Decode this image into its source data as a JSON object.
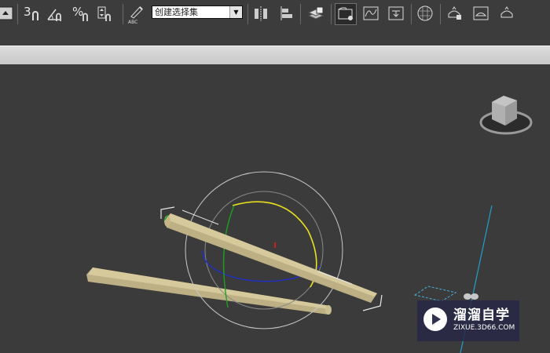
{
  "toolbar": {
    "snap_3_label": "3",
    "percent_label": "%",
    "abc_label": "ABC",
    "selection_set": {
      "value": "创建选择集"
    },
    "icons": [
      "undo-icon",
      "snap-3d-icon",
      "angle-snap-icon",
      "percent-snap-icon",
      "spinner-snap-icon",
      "edit-named-selection-icon",
      "mirror-icon",
      "align-icon",
      "layer-manager-icon",
      "scene-explorer-icon",
      "curve-editor-icon",
      "schematic-view-icon",
      "material-editor-icon",
      "render-setup-icon",
      "rendered-frame-window-icon",
      "render-production-icon"
    ]
  },
  "watermark": {
    "title": "溜溜自学",
    "url": "ZIXUE.3D66.COM"
  },
  "colors": {
    "viewport_bg": "#3b3b3b",
    "object_tan": "#c7b98a",
    "gizmo_x": "#d02020",
    "gizmo_y": "#e8e020",
    "gizmo_z": "#2030c8",
    "gizmo_view": "#c8c8c8",
    "camera_line": "#20a0c8"
  }
}
